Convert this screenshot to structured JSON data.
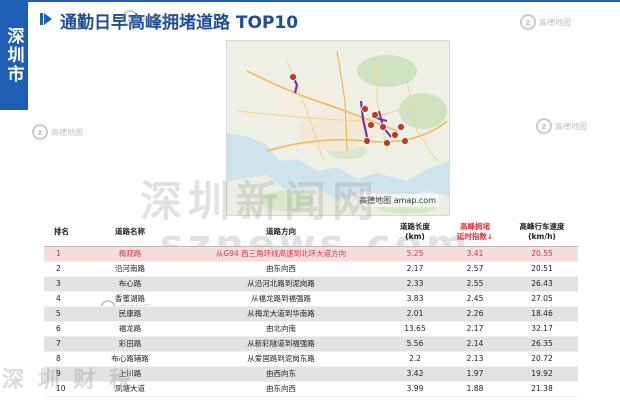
{
  "side_label": "深圳市",
  "title": "通勤日早高峰拥堵道路 TOP10",
  "map": {
    "logo_text": "高德地图",
    "logo_sub": "amap.com"
  },
  "watermarks": {
    "center_cn": "深圳新闻网",
    "center_url": "sznews.com",
    "bottom_left": "深 圳 财 税"
  },
  "corner_logo": {
    "badge": "z",
    "text": "高德地图"
  },
  "table": {
    "headers": [
      "排名",
      "道路名称",
      "道路方向",
      "道路长度\n(km)",
      "高峰拥堵\n延时指数↓",
      "高峰行车速度\n(km/h)"
    ],
    "rows": [
      {
        "rank": "1",
        "name": "梅观路",
        "direction": "从G94 西三角环线高速到北环大道方向",
        "length": "5.25",
        "index": "3.41",
        "speed": "20.55"
      },
      {
        "rank": "2",
        "name": "沿河南路",
        "direction": "由东向西",
        "length": "2.17",
        "index": "2.57",
        "speed": "20.51"
      },
      {
        "rank": "3",
        "name": "布心路",
        "direction": "从沿河北路到泥岗路",
        "length": "2.33",
        "index": "2.55",
        "speed": "26.43"
      },
      {
        "rank": "4",
        "name": "香蜜湖路",
        "direction": "从福龙路到福强路",
        "length": "3.83",
        "index": "2.45",
        "speed": "27.05"
      },
      {
        "rank": "5",
        "name": "民康路",
        "direction": "从梅龙大道到华南路",
        "length": "2.01",
        "index": "2.26",
        "speed": "18.46"
      },
      {
        "rank": "6",
        "name": "福龙路",
        "direction": "由北向南",
        "length": "13.65",
        "index": "2.17",
        "speed": "32.17"
      },
      {
        "rank": "7",
        "name": "彩田路",
        "direction": "从新彩隧道到福强路",
        "length": "5.56",
        "index": "2.14",
        "speed": "26.35"
      },
      {
        "rank": "8",
        "name": "布心路辅路",
        "direction": "从爱国路到泥岗东路",
        "length": "2.2",
        "index": "2.13",
        "speed": "20.72"
      },
      {
        "rank": "9",
        "name": "上川路",
        "direction": "由西向东",
        "length": "3.42",
        "index": "1.97",
        "speed": "19.92"
      },
      {
        "rank": "10",
        "name": "凤塘大道",
        "direction": "由东向西",
        "length": "3.99",
        "index": "1.88",
        "speed": "21.38"
      }
    ]
  },
  "colors": {
    "brand_blue": "#1f5fb3",
    "highlight_red": "#e0343f",
    "route_purple": "#7b2fa8",
    "marker_red": "#c0392b"
  }
}
